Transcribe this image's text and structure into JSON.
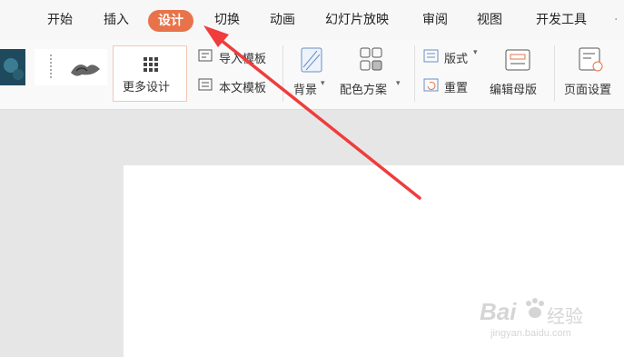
{
  "menu": {
    "tabs": [
      {
        "label": "开始"
      },
      {
        "label": "插入"
      },
      {
        "label": "设计"
      },
      {
        "label": "切换"
      },
      {
        "label": "动画"
      },
      {
        "label": "幻灯片放映"
      },
      {
        "label": "审阅"
      },
      {
        "label": "视图"
      },
      {
        "label": "开发工具"
      }
    ],
    "active_color": "#e8734a"
  },
  "ribbon": {
    "more_design": "更多设计",
    "import_template": "导入模板",
    "text_template": "本文模板",
    "background": "背景",
    "color_scheme": "配色方案",
    "layout": "版式",
    "reset": "重置",
    "edit_master": "编辑母版",
    "page_setup": "页面设置"
  },
  "watermark": {
    "brand": "Bai",
    "brand_suffix": "经验",
    "url": "jingyan.baidu.com"
  },
  "annotation": {
    "arrow_color": "#f03c3c"
  }
}
